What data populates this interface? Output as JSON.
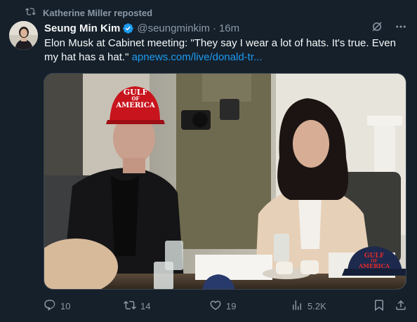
{
  "repost": {
    "label": "Katherine Miller reposted",
    "icon": "repost-icon"
  },
  "author": {
    "display_name": "Seung Min Kim",
    "handle": "@seungminkim",
    "separator": "·",
    "time": "16m",
    "verified_color": "#1d9bf0"
  },
  "tweet": {
    "text": "Elon Musk at Cabinet meeting: \"They say I wear a lot of hats. It's true. Even my hat has a hat.\" ",
    "link": "apnews.com/live/donald-tr..."
  },
  "photo": {
    "hat_front_line1": "GULF",
    "hat_front_line2": "OF",
    "hat_front_line3": "AMERICA",
    "hat_table_line1": "GULF",
    "hat_table_line2": "OF",
    "hat_table_line3": "AMERICA"
  },
  "actions": {
    "replies": "10",
    "reposts": "14",
    "likes": "19",
    "views": "5.2K"
  },
  "colors": {
    "background": "#15202b",
    "secondary_text": "#8b98a5",
    "accent": "#1d9bf0"
  }
}
